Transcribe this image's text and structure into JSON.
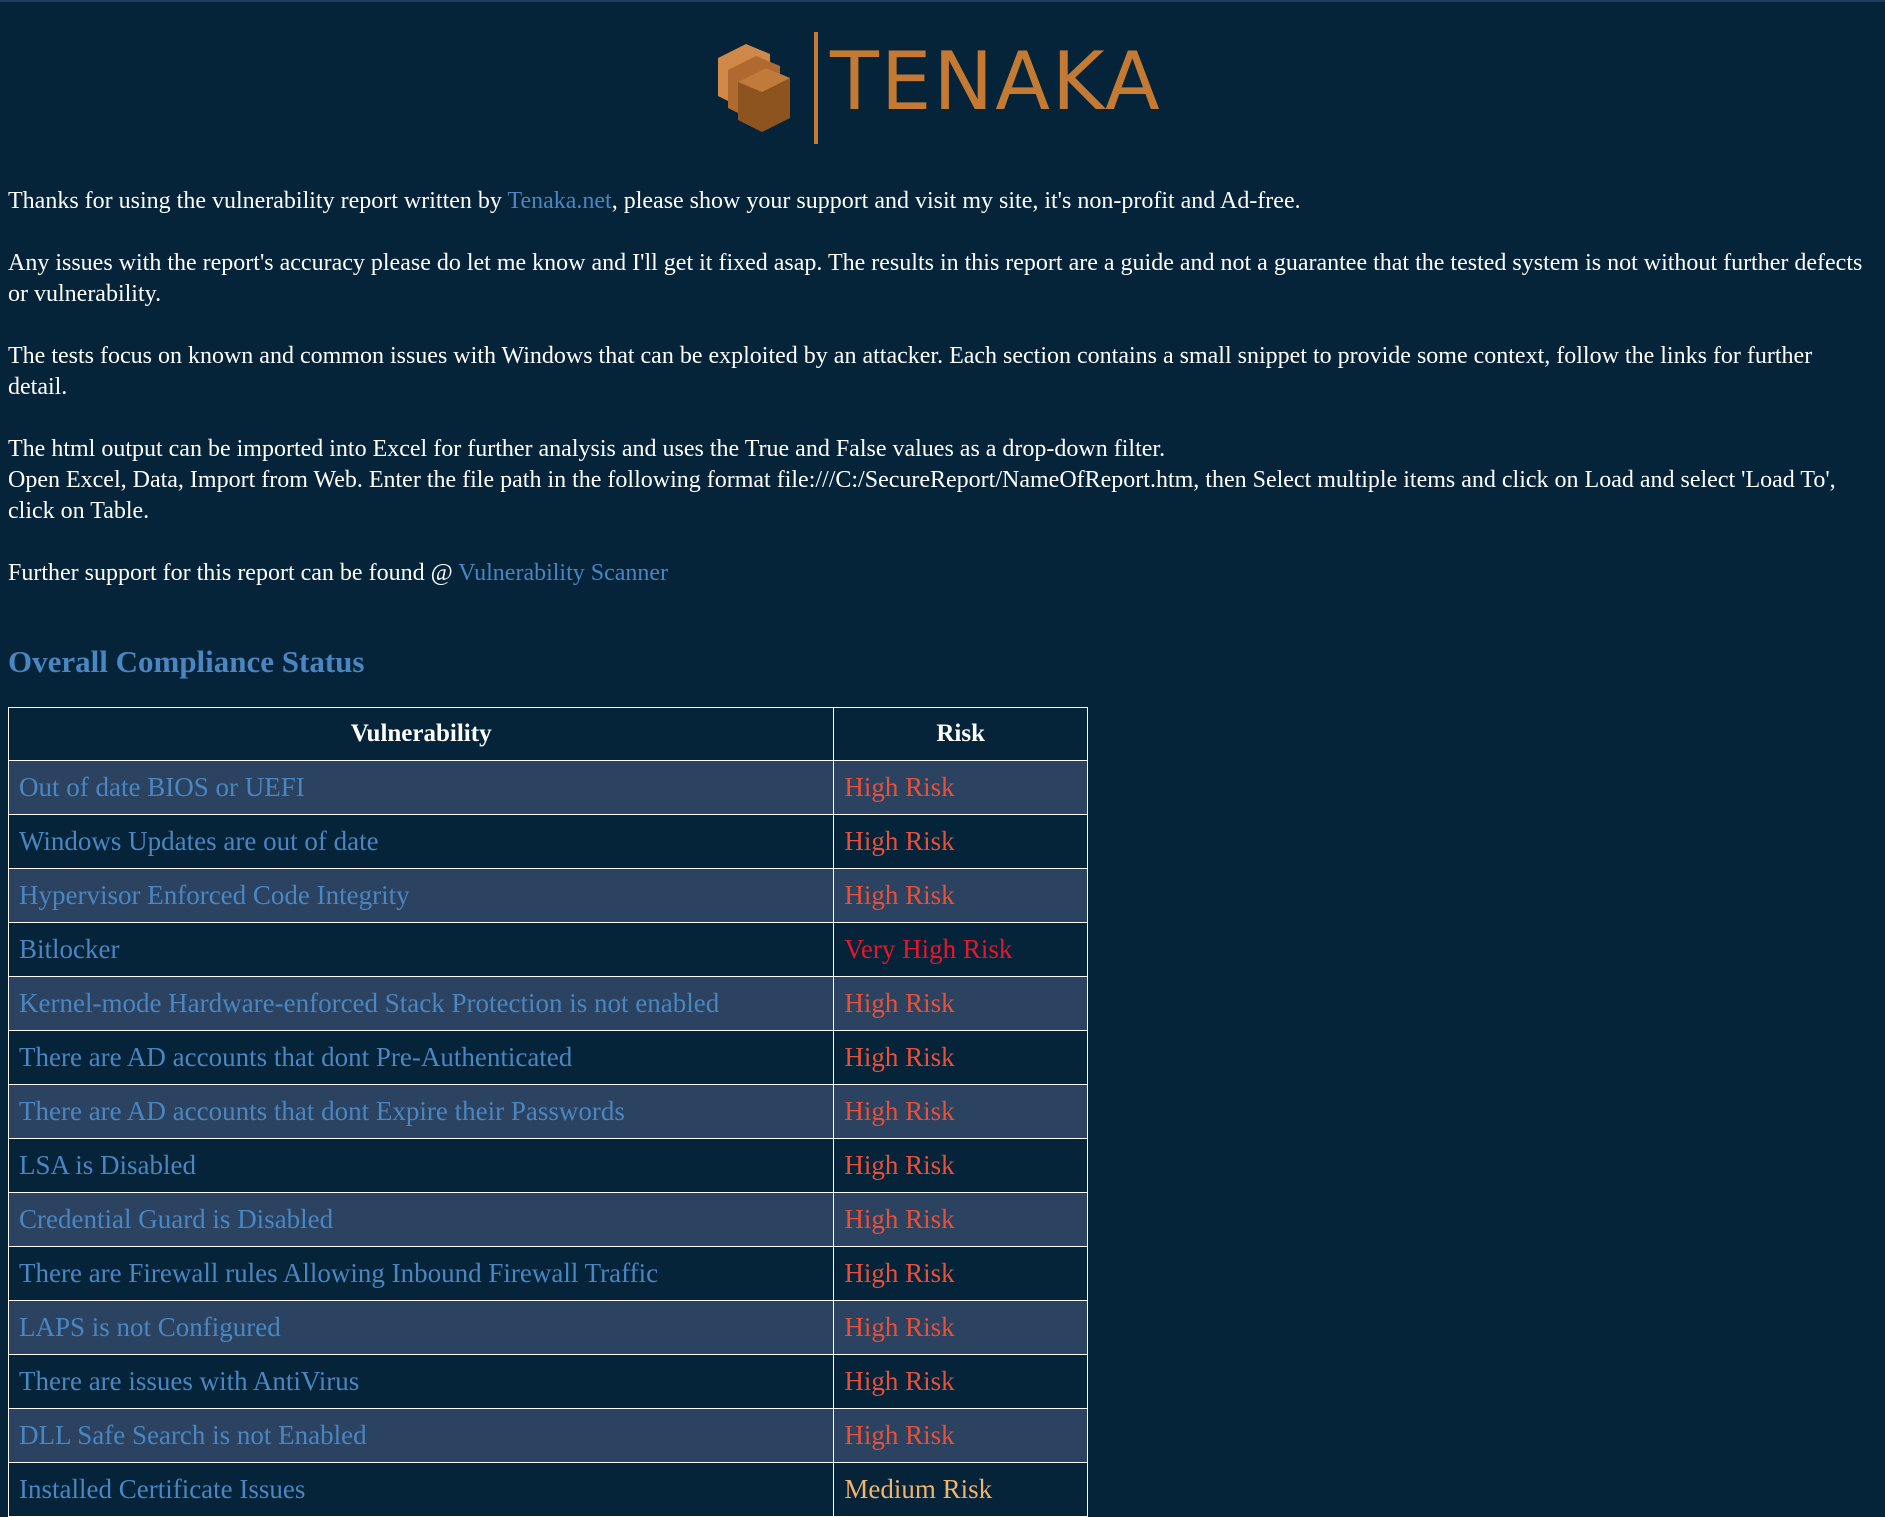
{
  "logo": {
    "text": "TENAKA"
  },
  "intro": {
    "p1_before": "Thanks for using the vulnerability report written by ",
    "p1_link": "Tenaka.net",
    "p1_after": ", please show your support and visit my site, it's non-profit and Ad-free.",
    "p2": "Any issues with the report's accuracy please do let me know and I'll get it fixed asap. The results in this report are a guide and not a guarantee that the tested system is not without further defects or vulnerability.",
    "p3": "The tests focus on known and common issues with Windows that can be exploited by an attacker. Each section contains a small snippet to provide some context, follow the links for further detail.",
    "p4a": "The html output can be imported into Excel for further analysis and uses the True and False values as a drop-down filter.",
    "p4b": "Open Excel, Data, Import from Web. Enter the file path in the following format file:///C:/SecureReport/NameOfReport.htm, then Select multiple items and click on Load and select 'Load To', click on Table.",
    "p5_before": "Further support for this report can be found @ ",
    "p5_link": "Vulnerability Scanner"
  },
  "section": {
    "title": "Overall Compliance Status"
  },
  "table": {
    "headers": {
      "vulnerability": "Vulnerability",
      "risk": "Risk"
    },
    "rows": [
      {
        "name": "Out of date BIOS or UEFI",
        "risk": "High Risk"
      },
      {
        "name": "Windows Updates are out of date",
        "risk": "High Risk"
      },
      {
        "name": "Hypervisor Enforced Code Integrity",
        "risk": "High Risk"
      },
      {
        "name": "Bitlocker",
        "risk": "Very High Risk"
      },
      {
        "name": "Kernel-mode Hardware-enforced Stack Protection is not enabled",
        "risk": "High Risk"
      },
      {
        "name": "There are AD accounts that dont Pre-Authenticated",
        "risk": "High Risk"
      },
      {
        "name": "There are AD accounts that dont Expire their Passwords",
        "risk": "High Risk"
      },
      {
        "name": "LSA is Disabled",
        "risk": "High Risk"
      },
      {
        "name": "Credential Guard is Disabled",
        "risk": "High Risk"
      },
      {
        "name": "There are Firewall rules Allowing Inbound Firewall Traffic",
        "risk": "High Risk"
      },
      {
        "name": "LAPS is not Configured",
        "risk": "High Risk"
      },
      {
        "name": "There are issues with AntiVirus",
        "risk": "High Risk"
      },
      {
        "name": "DLL Safe Search is not Enabled",
        "risk": "High Risk"
      },
      {
        "name": "Installed Certificate Issues",
        "risk": "Medium Risk"
      }
    ]
  },
  "colors": {
    "background": "#052439",
    "link": "#4a86c2",
    "row_alt": "#2b4360",
    "high_risk": "#e8503a",
    "very_high_risk": "#e8162a",
    "medium_risk": "#f2b36a",
    "brand": "#c47a32"
  }
}
